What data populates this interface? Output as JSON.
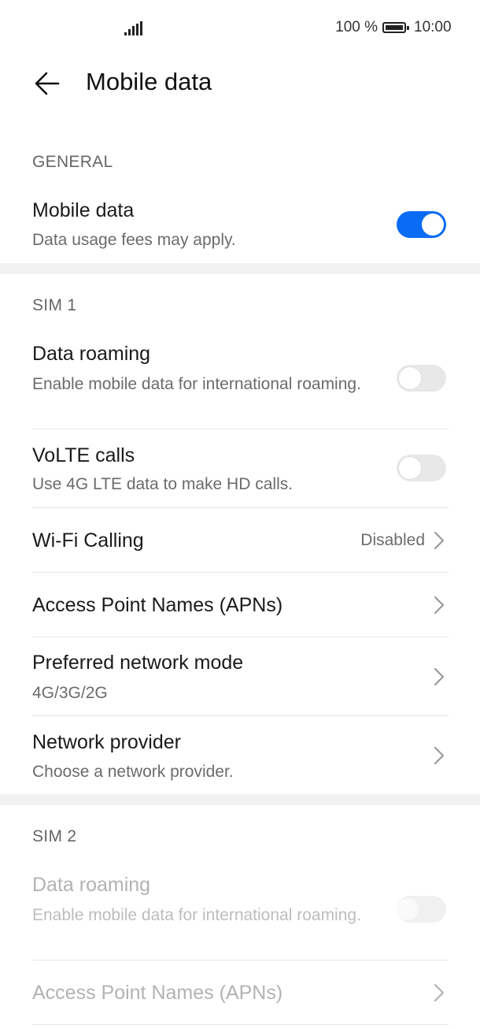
{
  "status_bar": {
    "battery": "100 %",
    "time": "10:00",
    "battery_level": 1.0
  },
  "header": {
    "title": "Mobile data"
  },
  "general": {
    "label": "GENERAL",
    "mobile_data": {
      "title": "Mobile data",
      "subtitle": "Data usage fees may apply.",
      "enabled": true
    }
  },
  "sim1": {
    "label": "SIM 1",
    "data_roaming": {
      "title": "Data roaming",
      "subtitle": "Enable mobile data for international roaming.",
      "enabled": false
    },
    "volte": {
      "title": "VoLTE calls",
      "subtitle": "Use 4G LTE data to make HD calls.",
      "enabled": false
    },
    "wifi_calling": {
      "title": "Wi-Fi Calling",
      "value": "Disabled"
    },
    "apn": {
      "title": "Access Point Names (APNs)"
    },
    "network_mode": {
      "title": "Preferred network mode",
      "subtitle": "4G/3G/2G"
    },
    "network_provider": {
      "title": "Network provider",
      "subtitle": "Choose a network provider."
    }
  },
  "sim2": {
    "label": "SIM 2",
    "data_roaming": {
      "title": "Data roaming",
      "subtitle": "Enable mobile data for international roaming.",
      "enabled": false
    },
    "apn": {
      "title": "Access Point Names (APNs)"
    }
  },
  "colors": {
    "accent": "#0a6cf5",
    "background": "#ffffff",
    "section_gap": "#f2f2f2"
  }
}
